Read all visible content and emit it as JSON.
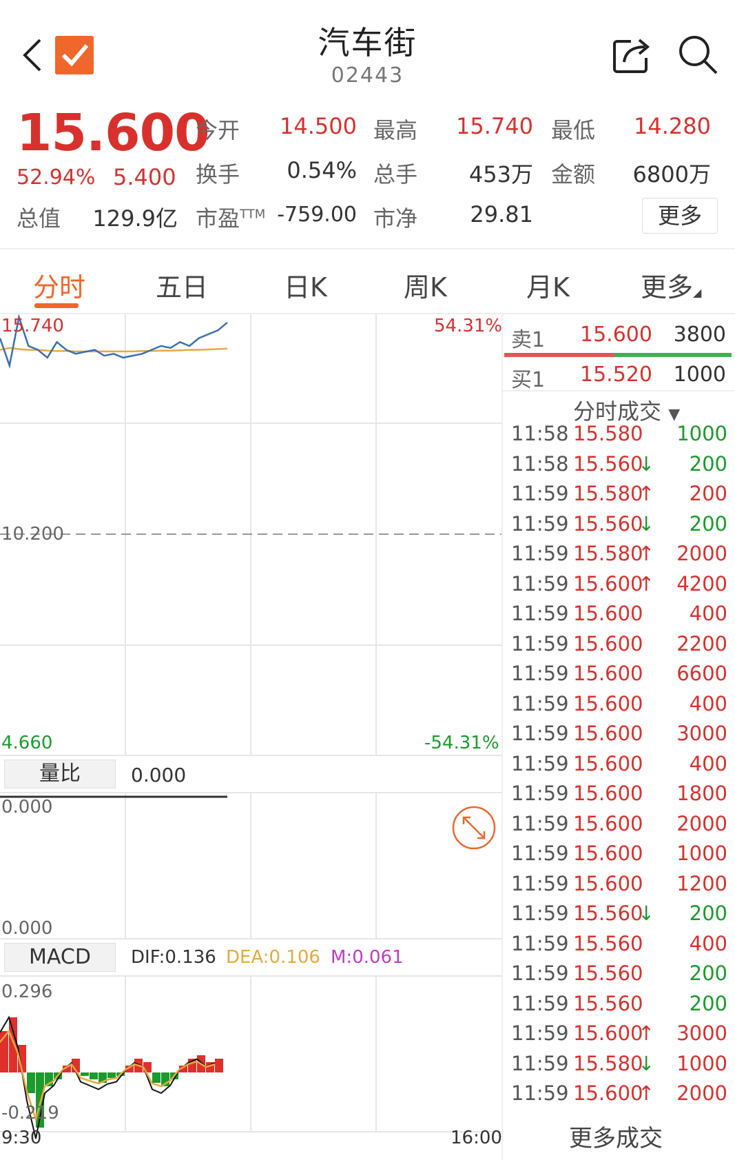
{
  "header": {
    "title": "汽车街",
    "code": "02443"
  },
  "quote": {
    "price": "15.600",
    "pct": "52.94%",
    "change": "5.400",
    "stats": [
      {
        "label": "今开",
        "value": "14.500",
        "color": "red"
      },
      {
        "label": "最高",
        "value": "15.740",
        "color": "red"
      },
      {
        "label": "最低",
        "value": "14.280",
        "color": "red"
      },
      {
        "label": "换手",
        "value": "0.54%",
        "color": "black"
      },
      {
        "label": "总手",
        "value": "453万",
        "color": "black"
      },
      {
        "label": "金额",
        "value": "6800万",
        "color": "black"
      },
      {
        "label": "总值",
        "value": "129.9亿",
        "color": "black"
      },
      {
        "label": "市盈",
        "sup": "TTM",
        "value": "-759.00",
        "color": "black"
      },
      {
        "label": "市净",
        "value": "29.81",
        "color": "black"
      }
    ],
    "more": "更多"
  },
  "tabs": [
    "分时",
    "五日",
    "日K",
    "周K",
    "月K",
    "更多"
  ],
  "chart": {
    "high_label": "15.740",
    "high_pct": "54.31%",
    "mid_label": "10.200",
    "low_label": "4.660",
    "low_pct": "-54.31%",
    "vol_label": "量比",
    "vol_value": "0.000",
    "vol_top": "0.000",
    "vol_bottom": "0.000",
    "macd_label": "MACD",
    "dif": "DIF:0.136",
    "dea": "DEA:0.106",
    "m": "M:0.061",
    "macd_top": "0.296",
    "macd_bottom": "-0.219",
    "time_start": "9:30",
    "time_end": "16:00"
  },
  "chart_data": {
    "type": "line",
    "series": [
      {
        "values": [
          15.2,
          14.5,
          15.74,
          15.0,
          14.9,
          14.7,
          15.1,
          14.9,
          14.8,
          14.85,
          14.9,
          14.75,
          14.8,
          14.7,
          14.75,
          14.8,
          14.9,
          15.0,
          14.95,
          15.1,
          15.0,
          15.2,
          15.3,
          15.4,
          15.6
        ]
      },
      {
        "values": [
          14.9,
          14.95,
          14.92,
          14.9,
          14.9,
          14.88,
          14.87,
          14.87,
          14.86,
          14.86,
          14.86,
          14.86,
          14.86,
          14.86,
          14.86,
          14.87,
          14.87,
          14.88,
          14.88,
          14.89,
          14.9,
          14.9,
          14.91,
          14.92,
          14.93
        ]
      }
    ],
    "ylim": [
      4.66,
      15.74
    ]
  },
  "colors": {
    "up": "#d8312d",
    "down": "#1c9a2c",
    "accent": "#f0662b"
  },
  "orderbook": {
    "ask": {
      "label": "卖1",
      "price": "15.600",
      "vol": "3800"
    },
    "bid": {
      "label": "买1",
      "price": "15.520",
      "vol": "1000"
    },
    "trades_title": "分时成交",
    "more_trades": "更多成交"
  },
  "trades": [
    {
      "t": "11:58",
      "p": "15.580",
      "a": "",
      "v": "1000",
      "vc": "green"
    },
    {
      "t": "11:58",
      "p": "15.560",
      "a": "↓",
      "v": "200",
      "vc": "green"
    },
    {
      "t": "11:59",
      "p": "15.580",
      "a": "↑",
      "v": "200",
      "vc": "red"
    },
    {
      "t": "11:59",
      "p": "15.560",
      "a": "↓",
      "v": "200",
      "vc": "green"
    },
    {
      "t": "11:59",
      "p": "15.580",
      "a": "↑",
      "v": "2000",
      "vc": "red"
    },
    {
      "t": "11:59",
      "p": "15.600",
      "a": "↑",
      "v": "4200",
      "vc": "red"
    },
    {
      "t": "11:59",
      "p": "15.600",
      "a": "",
      "v": "400",
      "vc": "red"
    },
    {
      "t": "11:59",
      "p": "15.600",
      "a": "",
      "v": "2200",
      "vc": "red"
    },
    {
      "t": "11:59",
      "p": "15.600",
      "a": "",
      "v": "6600",
      "vc": "red"
    },
    {
      "t": "11:59",
      "p": "15.600",
      "a": "",
      "v": "400",
      "vc": "red"
    },
    {
      "t": "11:59",
      "p": "15.600",
      "a": "",
      "v": "3000",
      "vc": "red"
    },
    {
      "t": "11:59",
      "p": "15.600",
      "a": "",
      "v": "400",
      "vc": "red"
    },
    {
      "t": "11:59",
      "p": "15.600",
      "a": "",
      "v": "1800",
      "vc": "red"
    },
    {
      "t": "11:59",
      "p": "15.600",
      "a": "",
      "v": "2000",
      "vc": "red"
    },
    {
      "t": "11:59",
      "p": "15.600",
      "a": "",
      "v": "1000",
      "vc": "red"
    },
    {
      "t": "11:59",
      "p": "15.600",
      "a": "",
      "v": "1200",
      "vc": "red"
    },
    {
      "t": "11:59",
      "p": "15.560",
      "a": "↓",
      "v": "200",
      "vc": "green"
    },
    {
      "t": "11:59",
      "p": "15.560",
      "a": "",
      "v": "400",
      "vc": "red"
    },
    {
      "t": "11:59",
      "p": "15.560",
      "a": "",
      "v": "200",
      "vc": "green"
    },
    {
      "t": "11:59",
      "p": "15.560",
      "a": "",
      "v": "200",
      "vc": "green"
    },
    {
      "t": "11:59",
      "p": "15.600",
      "a": "↑",
      "v": "3000",
      "vc": "red"
    },
    {
      "t": "11:59",
      "p": "15.580",
      "a": "↓",
      "v": "1000",
      "vc": "red"
    },
    {
      "t": "11:59",
      "p": "15.600",
      "a": "↑",
      "v": "2000",
      "vc": "red"
    }
  ]
}
